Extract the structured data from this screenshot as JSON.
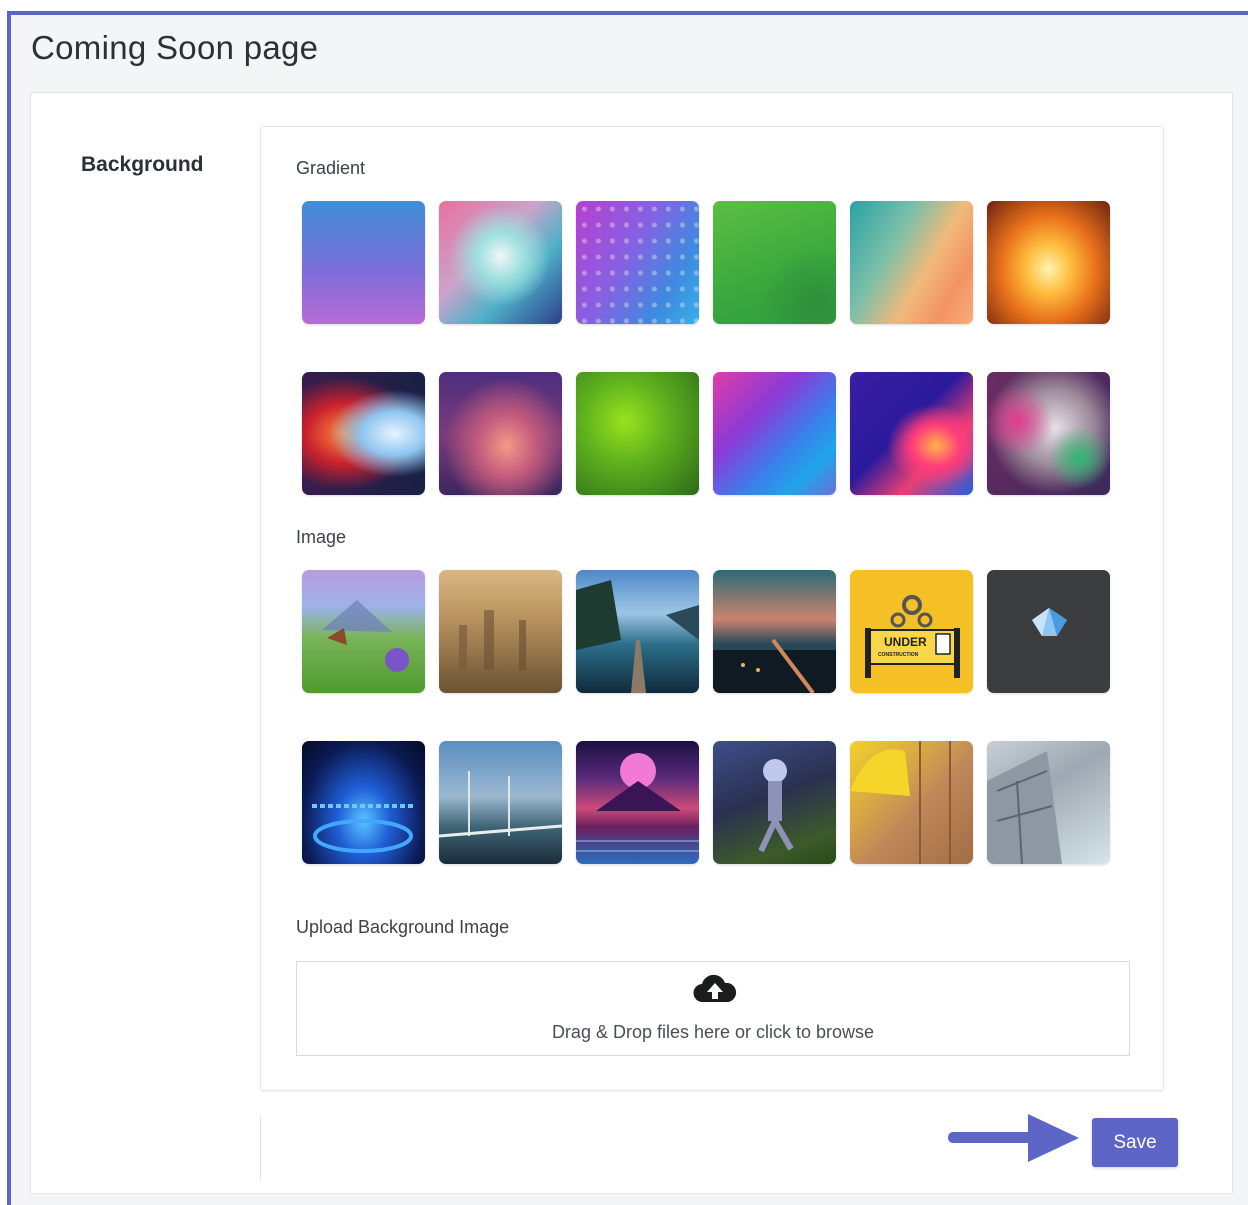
{
  "page": {
    "title": "Coming Soon page"
  },
  "background": {
    "section_label": "Background",
    "gradient_label": "Gradient",
    "image_label": "Image",
    "gradients": [
      {
        "name": "gradient-1"
      },
      {
        "name": "gradient-2"
      },
      {
        "name": "gradient-3"
      },
      {
        "name": "gradient-4"
      },
      {
        "name": "gradient-5"
      },
      {
        "name": "gradient-6"
      },
      {
        "name": "gradient-7"
      },
      {
        "name": "gradient-8"
      },
      {
        "name": "gradient-9"
      },
      {
        "name": "gradient-10"
      },
      {
        "name": "gradient-11"
      },
      {
        "name": "gradient-12"
      }
    ],
    "images": [
      {
        "name": "image-1"
      },
      {
        "name": "image-2"
      },
      {
        "name": "image-3"
      },
      {
        "name": "image-4"
      },
      {
        "name": "image-5",
        "sign_text": "UNDER",
        "sign_subtext": "CONSTRUCTION"
      },
      {
        "name": "image-6"
      },
      {
        "name": "image-7"
      },
      {
        "name": "image-8"
      },
      {
        "name": "image-9"
      },
      {
        "name": "image-10"
      },
      {
        "name": "image-11"
      },
      {
        "name": "image-12"
      }
    ]
  },
  "upload": {
    "label": "Upload Background Image",
    "icon": "cloud-upload-icon",
    "dropzone_text": "Drag & Drop files here or click to browse"
  },
  "actions": {
    "save_label": "Save",
    "arrow_icon": "arrow-right-icon"
  },
  "colors": {
    "accent": "#5d66c7",
    "text_primary": "#2d3136",
    "page_bg": "#f4f5f7"
  }
}
